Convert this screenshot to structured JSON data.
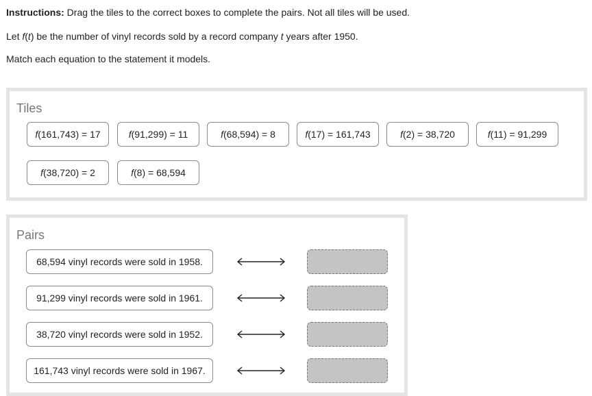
{
  "instructions": {
    "label": "Instructions:",
    "text": "Drag the tiles to the correct boxes to complete the pairs. Not all tiles will be used."
  },
  "context": {
    "part1": "Let ",
    "func": "f",
    "part2": "(",
    "var1": "t",
    "part3": ") be the number of vinyl records sold by a record company ",
    "var2": "t",
    "part4": " years after 1950."
  },
  "prompt": "Match each equation to the statement it models.",
  "tiles_panel": {
    "title": "Tiles",
    "tiles": [
      {
        "fn": "f",
        "text": "(161,743) = 17"
      },
      {
        "fn": "f",
        "text": "(91,299) = 11"
      },
      {
        "fn": "f",
        "text": "(68,594) = 8"
      },
      {
        "fn": "f",
        "text": "(17) = 161,743"
      },
      {
        "fn": "f",
        "text": "(2) = 38,720"
      },
      {
        "fn": "f",
        "text": "(11) = 91,299"
      },
      {
        "fn": "f",
        "text": "(38,720) = 2"
      },
      {
        "fn": "f",
        "text": "(8) = 68,594"
      }
    ]
  },
  "pairs_panel": {
    "title": "Pairs",
    "pairs": [
      {
        "statement": "68,594 vinyl records were sold in 1958.",
        "arrow_icon": "double-arrow-icon"
      },
      {
        "statement": "91,299 vinyl records were sold in 1961.",
        "arrow_icon": "double-arrow-icon"
      },
      {
        "statement": "38,720 vinyl records were sold in 1952.",
        "arrow_icon": "double-arrow-icon"
      },
      {
        "statement": "161,743 vinyl records were sold in 1967.",
        "arrow_icon": "double-arrow-icon"
      }
    ]
  },
  "colors": {
    "panel_border": "#e4e4e4",
    "tile_border": "#8a8a8a",
    "dropbox_fill": "#c4c4c4",
    "title_text": "#777777"
  }
}
